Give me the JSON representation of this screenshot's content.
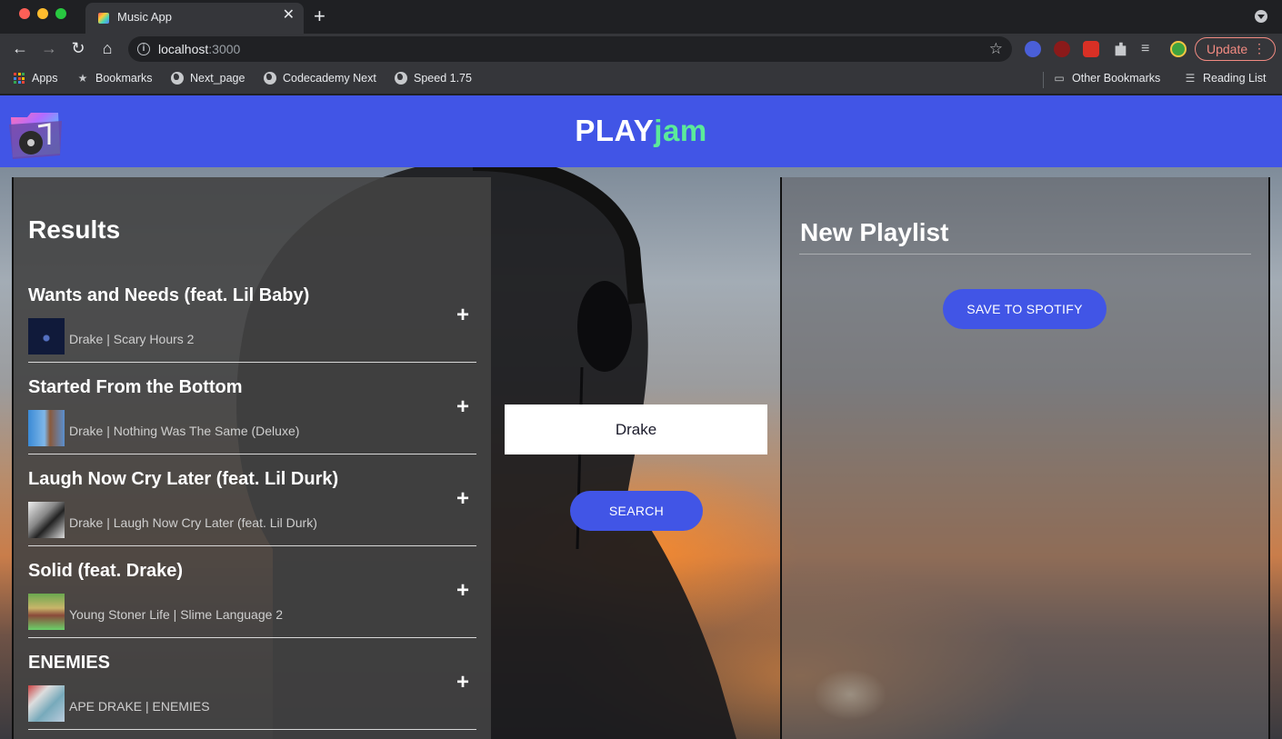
{
  "browser": {
    "tab_title": "Music App",
    "tab_close": "✕",
    "new_tab": "+",
    "url_host": "localhost",
    "url_port": ":3000",
    "update_label": "Update",
    "update_menu": "⋮",
    "bookmarks": {
      "apps": "Apps",
      "bookmarks": "Bookmarks",
      "next_page": "Next_page",
      "codecademy": "Codecademy Next",
      "speed": "Speed 1.75",
      "other": "Other Bookmarks",
      "reading": "Reading List"
    }
  },
  "app": {
    "brand_play": "PLAY",
    "brand_jam": "jam",
    "colors": {
      "primary": "#4155e6",
      "accent": "#5bea9a"
    }
  },
  "results": {
    "title": "Results",
    "add_symbol": "+",
    "tracks": [
      {
        "name": "Wants and Needs (feat. Lil Baby)",
        "meta": "Drake | Scary Hours 2"
      },
      {
        "name": "Started From the Bottom",
        "meta": "Drake | Nothing Was The Same (Deluxe)"
      },
      {
        "name": "Laugh Now Cry Later (feat. Lil Durk)",
        "meta": "Drake | Laugh Now Cry Later (feat. Lil Durk)"
      },
      {
        "name": "Solid (feat. Drake)",
        "meta": "Young Stoner Life | Slime Language 2"
      },
      {
        "name": "ENEMIES",
        "meta": "APE DRAKE | ENEMIES"
      }
    ]
  },
  "search": {
    "value": "Drake",
    "button_label": "SEARCH"
  },
  "playlist": {
    "title": "New Playlist",
    "save_label": "SAVE TO SPOTIFY"
  }
}
